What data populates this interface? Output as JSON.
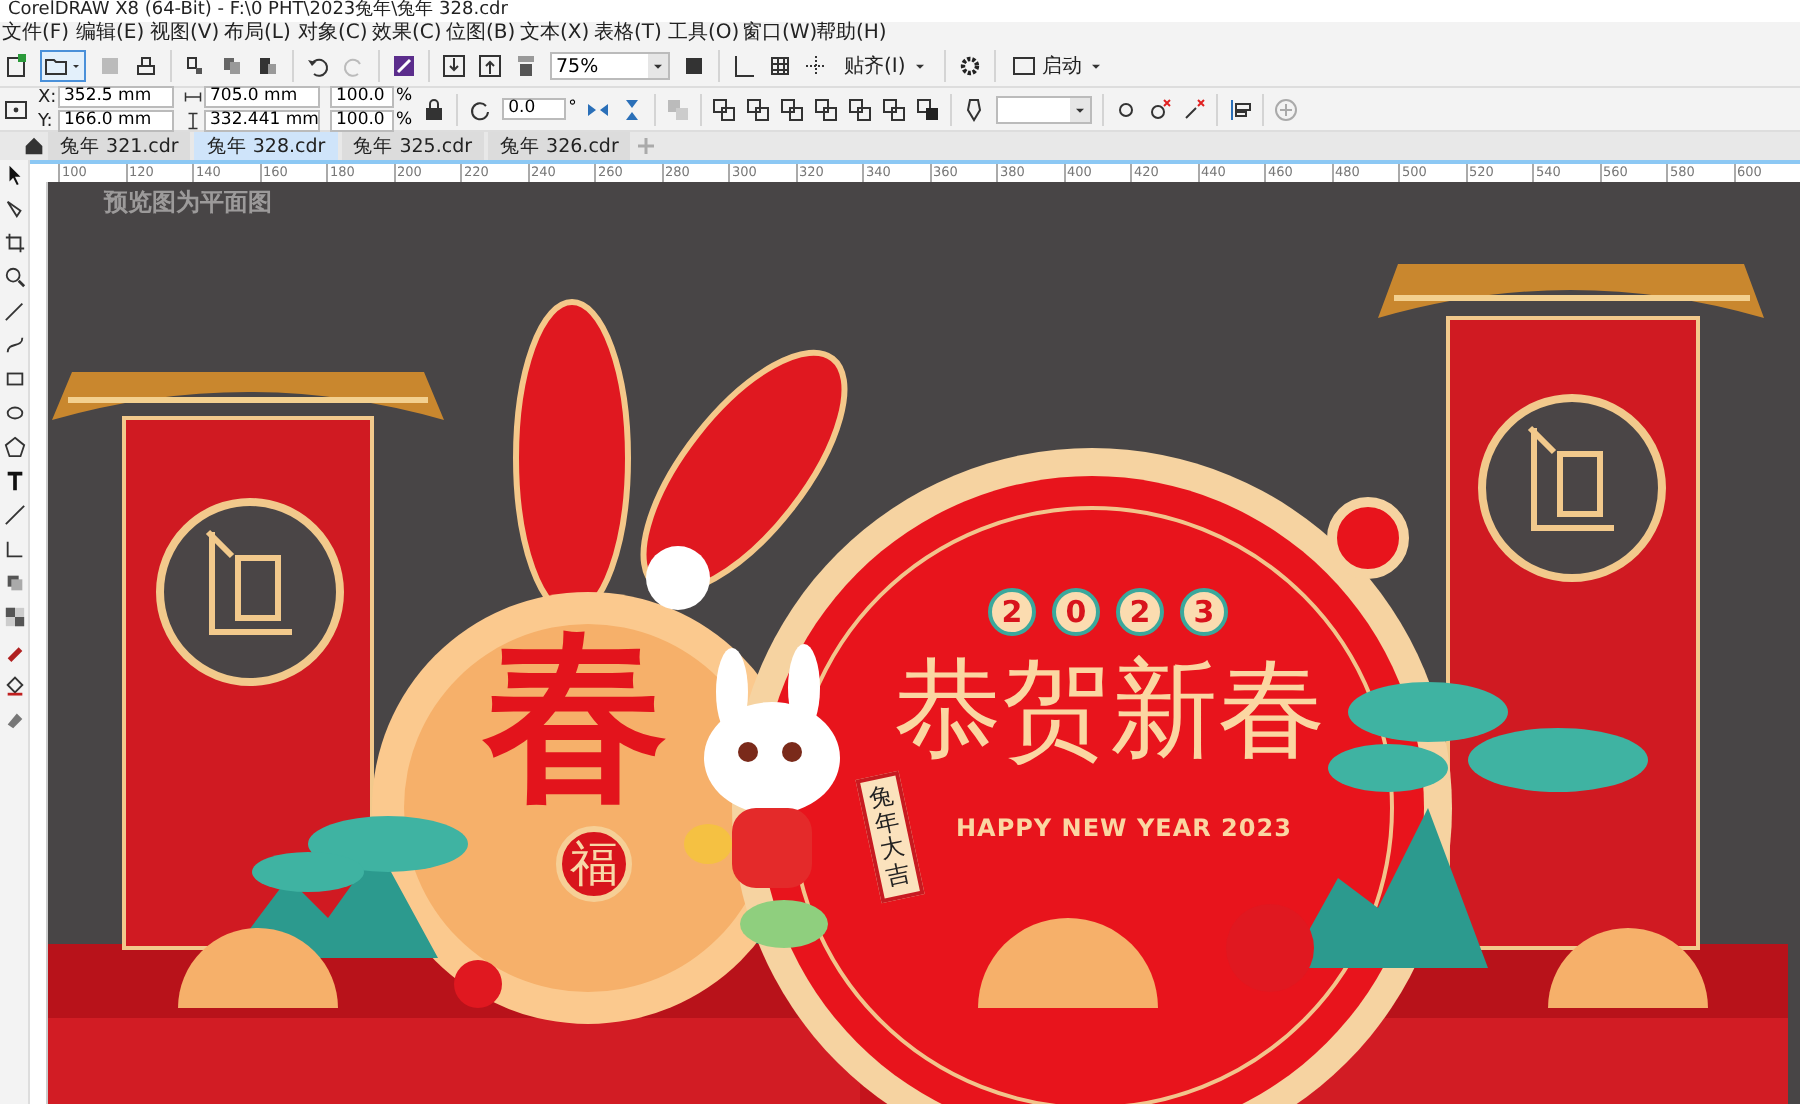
{
  "window": {
    "title": "CorelDRAW X8 (64-Bit) - F:\\0 PHT\\2023兔年\\兔年 328.cdr"
  },
  "menu": [
    "文件(F)",
    "编辑(E)",
    "视图(V)",
    "布局(L)",
    "对象(C)",
    "效果(C)",
    "位图(B)",
    "文本(X)",
    "表格(T)",
    "工具(O)",
    "窗口(W)",
    "帮助(H)"
  ],
  "toolbar": {
    "zoom": "75%",
    "snap": "贴齐(I)",
    "launch": "启动"
  },
  "properties": {
    "x_label": "X:",
    "x": "352.5 mm",
    "y_label": "Y:",
    "y": "166.0 mm",
    "width": "705.0 mm",
    "height": "332.441 mm",
    "scales": [
      {
        "value": "100.0",
        "unit": "%"
      },
      {
        "value": "100.0",
        "unit": "%"
      }
    ],
    "rotation": "0.0",
    "rotation_unit": "°"
  },
  "tabs": [
    {
      "label": "兔年 321.cdr",
      "selected": false
    },
    {
      "label": "兔年 328.cdr",
      "selected": true
    },
    {
      "label": "兔年 325.cdr",
      "selected": false
    },
    {
      "label": "兔年 326.cdr",
      "selected": false
    }
  ],
  "ruler": [
    "100",
    "120",
    "140",
    "160",
    "180",
    "200",
    "220",
    "240",
    "260",
    "280",
    "300",
    "320",
    "340",
    "360",
    "380",
    "400",
    "420",
    "440",
    "460",
    "480",
    "500",
    "520",
    "540",
    "560",
    "580",
    "600"
  ],
  "canvas": {
    "note": "预览图为平面图",
    "artwork": {
      "big_character": "春",
      "seal_character": "福",
      "year_digits": [
        "2",
        "0",
        "2",
        "3"
      ],
      "headline": "恭贺新春",
      "subtitle": "HAPPY NEW YEAR 2023",
      "scroll_text": "兔年大吉"
    }
  }
}
